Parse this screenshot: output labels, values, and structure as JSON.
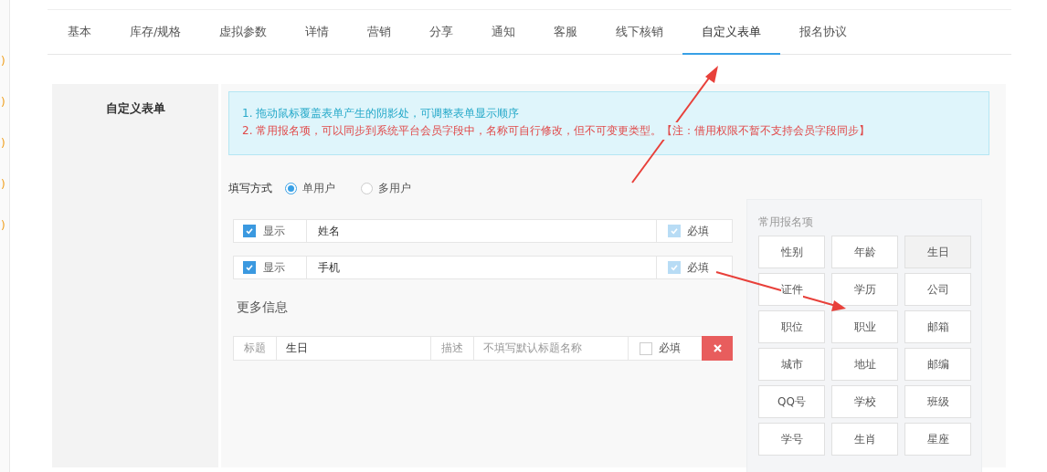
{
  "sidebar_marks": [
    ")",
    ")",
    ")",
    ")",
    ")"
  ],
  "tabs": [
    {
      "label": "基本",
      "selected": false
    },
    {
      "label": "库存/规格",
      "selected": false
    },
    {
      "label": "虚拟参数",
      "selected": false
    },
    {
      "label": "详情",
      "selected": false
    },
    {
      "label": "营销",
      "selected": false
    },
    {
      "label": "分享",
      "selected": false
    },
    {
      "label": "通知",
      "selected": false
    },
    {
      "label": "客服",
      "selected": false
    },
    {
      "label": "线下核销",
      "selected": false
    },
    {
      "label": "自定义表单",
      "selected": true
    },
    {
      "label": "报名协议",
      "selected": false
    }
  ],
  "section_label": "自定义表单",
  "notice": {
    "lines": [
      {
        "kind": "info",
        "text": "1. 拖动鼠标覆盖表单产生的阴影处，可调整表单显示顺序"
      },
      {
        "kind": "warning",
        "text": "2. 常用报名项，可以同步到系统平台会员字段中，名称可自行修改，但不可变更类型。【注：借用权限不暂不支持会员字段同步】"
      }
    ]
  },
  "fill_mode": {
    "label": "填写方式",
    "options": [
      {
        "label": "单用户",
        "selected": true
      },
      {
        "label": "多用户",
        "selected": false
      }
    ]
  },
  "fixed_fields": [
    {
      "show_label": "显示",
      "shown": true,
      "name": "姓名",
      "required_label": "必填",
      "required": true
    },
    {
      "show_label": "显示",
      "shown": true,
      "name": "手机",
      "required_label": "必填",
      "required": true
    }
  ],
  "more_info": {
    "title": "更多信息",
    "fields": [
      {
        "title_label": "标题",
        "title": "生日",
        "desc_label": "描述",
        "desc_placeholder": "不填写默认标题名称",
        "required_label": "必填",
        "required": false
      }
    ]
  },
  "palette": {
    "title": "常用报名项",
    "items": [
      {
        "label": "性别",
        "selected": false
      },
      {
        "label": "年龄",
        "selected": false
      },
      {
        "label": "生日",
        "selected": true
      },
      {
        "label": "证件",
        "selected": false
      },
      {
        "label": "学历",
        "selected": false
      },
      {
        "label": "公司",
        "selected": false
      },
      {
        "label": "职位",
        "selected": false
      },
      {
        "label": "职业",
        "selected": false
      },
      {
        "label": "邮箱",
        "selected": false
      },
      {
        "label": "城市",
        "selected": false
      },
      {
        "label": "地址",
        "selected": false
      },
      {
        "label": "邮编",
        "selected": false
      },
      {
        "label": "QQ号",
        "selected": false
      },
      {
        "label": "学校",
        "selected": false
      },
      {
        "label": "班级",
        "selected": false
      },
      {
        "label": "学号",
        "selected": false
      },
      {
        "label": "生肖",
        "selected": false
      },
      {
        "label": "星座",
        "selected": false
      }
    ]
  }
}
